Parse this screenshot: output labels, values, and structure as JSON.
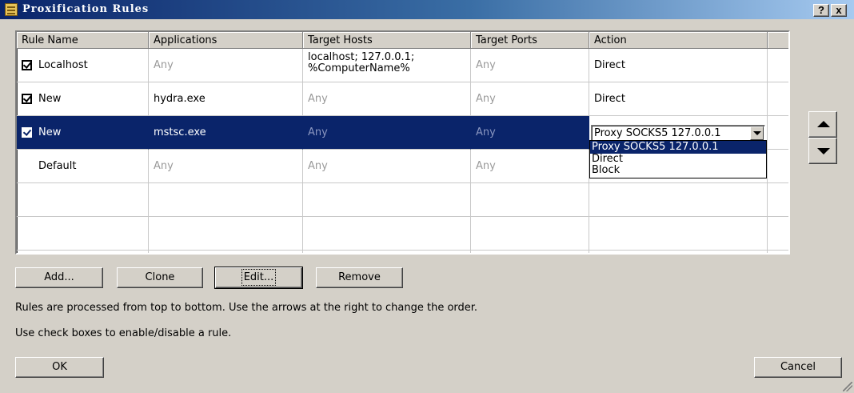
{
  "window": {
    "title": "Proxification Rules",
    "help_label": "?",
    "close_label": "x"
  },
  "columns": [
    "Rule Name",
    "Applications",
    "Target Hosts",
    "Target Ports",
    "Action"
  ],
  "rules": [
    {
      "name": "Localhost",
      "checked": true,
      "applications": "Any",
      "hosts_line1": "localhost; 127.0.0.1;",
      "hosts_line2": "%ComputerName%",
      "ports": "Any",
      "action": "Direct"
    },
    {
      "name": "New",
      "checked": true,
      "applications": "hydra.exe",
      "hosts": "Any",
      "ports": "Any",
      "action": "Direct"
    },
    {
      "name": "New",
      "checked": true,
      "applications": "mstsc.exe",
      "hosts": "Any",
      "ports": "Any",
      "action": "Proxy SOCKS5 127.0.0.1",
      "selected": true
    },
    {
      "name": "Default",
      "checked": false,
      "applications": "Any",
      "hosts": "Any",
      "ports": "Any",
      "action": ""
    }
  ],
  "action_dropdown": {
    "options": [
      "Proxy SOCKS5 127.0.0.1",
      "Direct",
      "Block"
    ],
    "selected": "Proxy SOCKS5 127.0.0.1"
  },
  "buttons": {
    "add": "Add...",
    "clone": "Clone",
    "edit": "Edit...",
    "remove": "Remove",
    "ok": "OK",
    "cancel": "Cancel"
  },
  "info": {
    "line1": "Rules are processed from top to bottom. Use the arrows at the right to change the order.",
    "line2": "Use check boxes to enable/disable a rule."
  },
  "colors": {
    "title_gradient_start": "#0a246a",
    "selection": "#0a246a",
    "face": "#d4d0c8"
  }
}
